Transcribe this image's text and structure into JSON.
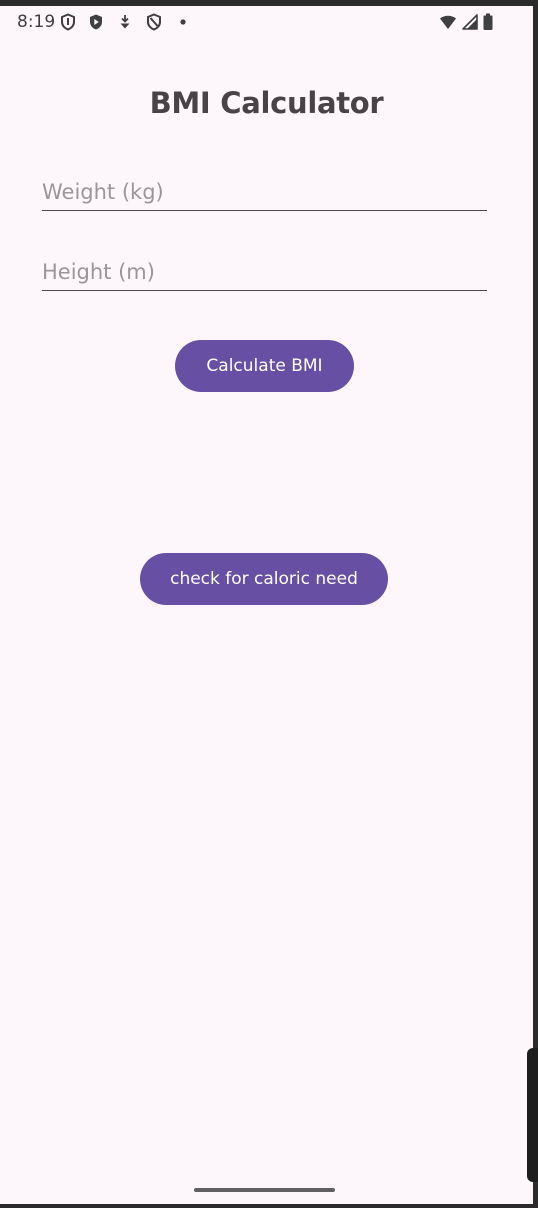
{
  "status_bar": {
    "time": "8:19"
  },
  "app": {
    "title": "BMI Calculator"
  },
  "form": {
    "weight_placeholder": "Weight (kg)",
    "weight_value": "",
    "height_placeholder": "Height (m)",
    "height_value": ""
  },
  "buttons": {
    "calculate_label": "Calculate BMI",
    "caloric_label": "check for caloric need"
  },
  "colors": {
    "accent": "#6750a4",
    "background": "#fdf7fc",
    "title_text": "#474347"
  }
}
